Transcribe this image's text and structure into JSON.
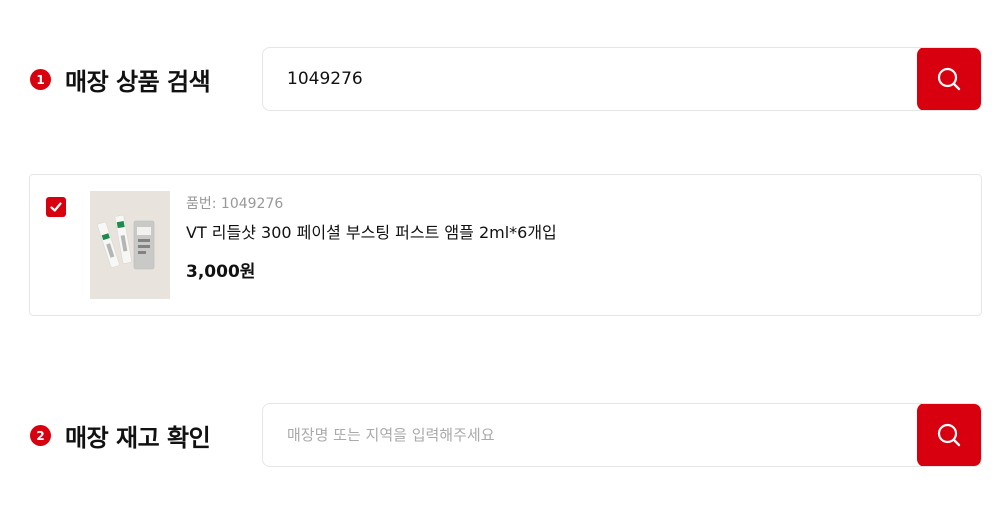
{
  "section1": {
    "step": "1",
    "title": "매장 상품 검색",
    "search_value": "1049276",
    "search_placeholder": ""
  },
  "product": {
    "checked": true,
    "code_label": "품번: 1049276",
    "name": "VT 리들샷 300 페이셜 부스팅 퍼스트 앰플 2ml*6개입",
    "price": "3,000원"
  },
  "section2": {
    "step": "2",
    "title": "매장 재고 확인",
    "search_value": "",
    "search_placeholder": "매장명 또는 지역을 입력해주세요"
  },
  "icons": {
    "search": "search-icon",
    "check": "check-icon"
  },
  "colors": {
    "accent": "#d8000f",
    "border": "#e6e6e6",
    "muted": "#999999"
  }
}
